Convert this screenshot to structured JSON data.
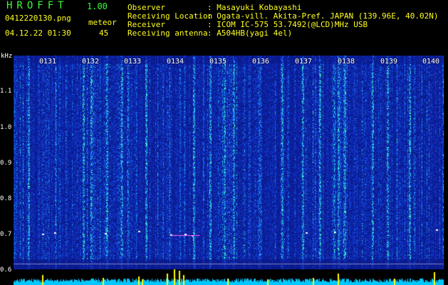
{
  "header": {
    "logo": "HROFFT",
    "version": "1.00",
    "filename": "0412220130.png",
    "datetime": "04.12.22 01:30",
    "meteor_label": "meteor",
    "meteor_count": "45",
    "info": [
      {
        "key": "Observer",
        "value": ": Masayuki Kobayashi"
      },
      {
        "key": "Receiving Location",
        "value": ": Ogata-vill. Akita-Pref. JAPAN (139.96E, 40.02N)"
      },
      {
        "key": "Receiver",
        "value": ": ICOM IC-575 53.7492(@LCD)MHz USB"
      },
      {
        "key": "Receiving antenna",
        "value": ": A504HB(yagi 4el)"
      }
    ]
  },
  "spectrogram": {
    "freq_unit": "kHz",
    "freq_ticks": [
      "1.1",
      "1.0",
      "0.9",
      "0.8",
      "0.7",
      "0.6"
    ],
    "time_ticks": [
      "0131",
      "0132",
      "0133",
      "0134",
      "0135",
      "0136",
      "0137",
      "0138",
      "0139",
      "0140"
    ],
    "colors": {
      "background": "#0a1a8c",
      "noise_low": "#1030d0",
      "noise_mid": "#20a0ff",
      "noise_high": "#40ffd0",
      "meteor": "#ffffff",
      "signal": "#ffff00",
      "level_bar": "#00c8ff"
    }
  }
}
